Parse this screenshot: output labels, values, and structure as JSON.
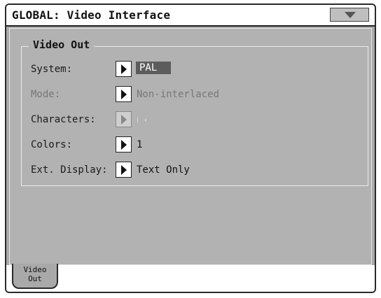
{
  "header": {
    "title": "GLOBAL: Video Interface"
  },
  "group": {
    "title": "Video Out"
  },
  "params": [
    {
      "label": "System:",
      "value": "PAL",
      "enabled": true,
      "selected": true
    },
    {
      "label": "Mode:",
      "value": "Non-interlaced",
      "enabled": false,
      "selected": false
    },
    {
      "label": "Characters:",
      "value": "⁞ ‹",
      "enabled": false,
      "selected": false
    },
    {
      "label": "Colors:",
      "value": "1",
      "enabled": true,
      "selected": false
    },
    {
      "label": "Ext. Display:",
      "value": "Text Only",
      "enabled": true,
      "selected": false
    }
  ],
  "tabs": [
    {
      "line1": "Video",
      "line2": "Out",
      "active": true
    }
  ],
  "icons": {
    "menu": "page-menu-triangle-icon",
    "param": "popup-arrow-icon"
  },
  "colors": {
    "background": "#b2b2b2",
    "selected_value_bg": "#5c5c5c",
    "frame": "#2a2a2a"
  }
}
